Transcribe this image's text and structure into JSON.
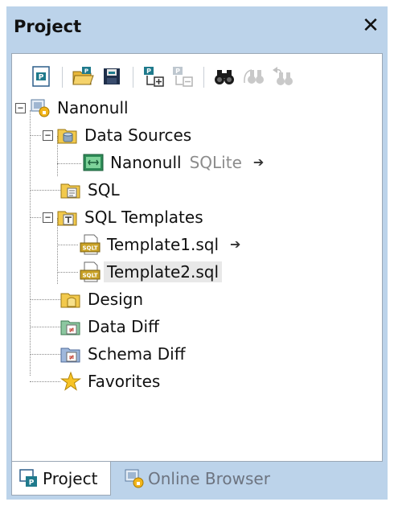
{
  "window": {
    "title": "Project",
    "close_symbol": "✕"
  },
  "toolbar": {
    "buttons": [
      {
        "name": "new-project-icon"
      },
      {
        "name": "open-project-icon"
      },
      {
        "name": "save-project-icon"
      },
      {
        "name": "add-to-project-icon"
      },
      {
        "name": "remove-from-project-icon"
      },
      {
        "name": "find-icon"
      },
      {
        "name": "find-next-icon"
      },
      {
        "name": "replace-icon"
      }
    ]
  },
  "tree": {
    "root": {
      "label": "Nanonull"
    },
    "data_sources": {
      "label": "Data Sources"
    },
    "datasource_item": {
      "label": "Nanonull",
      "hint": "SQLite",
      "arrow": "➔"
    },
    "sql": {
      "label": "SQL"
    },
    "sql_templates": {
      "label": "SQL Templates"
    },
    "template1": {
      "label": "Template1.sql",
      "arrow": "➔"
    },
    "template2": {
      "label": "Template2.sql"
    },
    "design": {
      "label": "Design"
    },
    "data_diff": {
      "label": "Data Diff"
    },
    "schema_diff": {
      "label": "Schema Diff"
    },
    "favorites": {
      "label": "Favorites"
    }
  },
  "tabs": [
    {
      "label": "Project",
      "active": true
    },
    {
      "label": "Online Browser",
      "active": false
    }
  ],
  "colors": {
    "pane_background": "#bcd3ea",
    "folder_yellow": "#f2c94c",
    "selection": "#e8e8e8"
  }
}
